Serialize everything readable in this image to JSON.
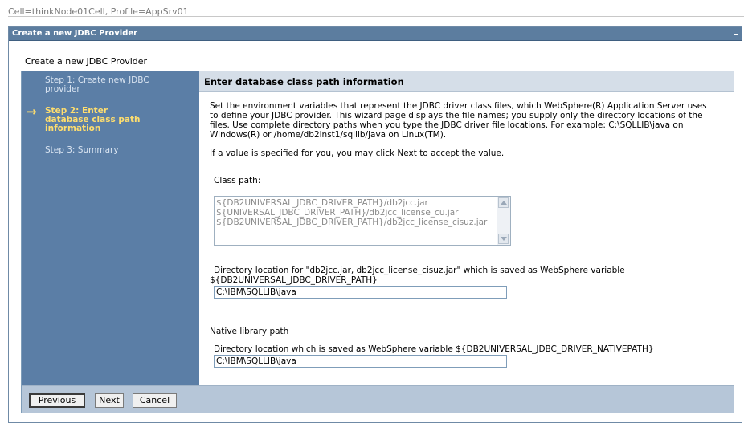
{
  "cell_profile": "Cell=thinkNode01Cell, Profile=AppSrv01",
  "portlet": {
    "title": "Create a new JDBC Provider"
  },
  "wizard": {
    "heading": "Create a new JDBC Provider",
    "steps": [
      {
        "label": "Step 1: Create new JDBC provider",
        "current": false
      },
      {
        "label": "Step 2: Enter database class path information",
        "current": true
      },
      {
        "label": "Step 3: Summary",
        "current": false
      }
    ],
    "current_marker": "→"
  },
  "content": {
    "title": "Enter database class path information",
    "intro": "Set the environment variables that represent the JDBC driver class files, which WebSphere(R) Application Server uses to define your JDBC provider. This wizard page displays the file names; you supply only the directory locations of the files. Use complete directory paths when you type the JDBC driver file locations. For example: C:\\SQLLIB\\java on Windows(R) or /home/db2inst1/sqllib/java on Linux(TM).",
    "accept_note": "If a value is specified for you, you may click Next to accept the value.",
    "classpath": {
      "label": "Class path:",
      "value": "${DB2UNIVERSAL_JDBC_DRIVER_PATH}/db2jcc.jar\n${UNIVERSAL_JDBC_DRIVER_PATH}/db2jcc_license_cu.jar\n${DB2UNIVERSAL_JDBC_DRIVER_PATH}/db2jcc_license_cisuz.jar"
    },
    "driver_dir": {
      "label_line1": "Directory location for \"db2jcc.jar, db2jcc_license_cisuz.jar\" which is saved as WebSphere variable",
      "label_line2": "${DB2UNIVERSAL_JDBC_DRIVER_PATH}",
      "value": "C:\\IBM\\SQLLIB\\java"
    },
    "native_library": {
      "section_label": "Native library path",
      "label": "Directory location which is saved as WebSphere variable ${DB2UNIVERSAL_JDBC_DRIVER_NATIVEPATH}",
      "value": "C:\\IBM\\SQLLIB\\java"
    }
  },
  "buttons": {
    "previous": "Previous",
    "next": "Next",
    "cancel": "Cancel"
  },
  "colors": {
    "title_bar": "#5c7d9f",
    "steps_panel": "#5b7ea6",
    "current_step": "#ffde6e",
    "content_header": "#d5dee8",
    "button_bar": "#b6c6d8"
  }
}
